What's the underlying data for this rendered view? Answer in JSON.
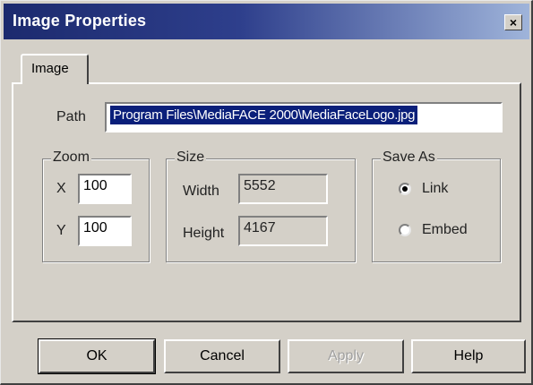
{
  "window": {
    "title": "Image Properties",
    "close_glyph": "×"
  },
  "tabs": [
    {
      "label": "Image",
      "selected": true
    }
  ],
  "path": {
    "label": "Path",
    "value": "Program Files\\MediaFACE 2000\\MediaFaceLogo.jpg"
  },
  "zoom": {
    "title": "Zoom",
    "x_label": "X",
    "x_value": "100",
    "y_label": "Y",
    "y_value": "100"
  },
  "size": {
    "title": "Size",
    "width_label": "Width",
    "width_value": "5552",
    "height_label": "Height",
    "height_value": "4167"
  },
  "save_as": {
    "title": "Save As",
    "options": [
      {
        "label": "Link",
        "selected": true
      },
      {
        "label": "Embed",
        "selected": false
      }
    ]
  },
  "buttons": {
    "ok": "OK",
    "cancel": "Cancel",
    "apply": "Apply",
    "help": "Help"
  },
  "colors": {
    "title_bar_start": "#1c2a6e",
    "title_bar_end": "#9fb4da",
    "face": "#d4d0c8",
    "selection": "#0a1f7a"
  }
}
